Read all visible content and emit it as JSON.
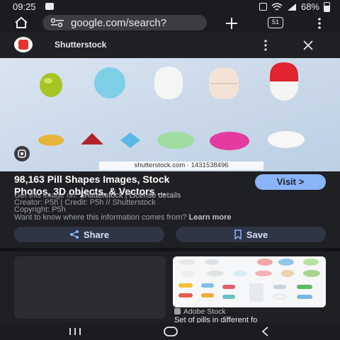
{
  "status_bar": {
    "time": "09:25",
    "battery": "68%"
  },
  "browser": {
    "url": "google.com/search?",
    "tab_count": "51"
  },
  "sheet": {
    "site_name": "Shutterstock"
  },
  "image": {
    "watermark": "shutterstock.com · 1431538496"
  },
  "result": {
    "title_line1": "98,163 Pill Shapes Images, Stock",
    "title_line2": "Photos, 3D objects, & Vectors ...",
    "visit_label": "Visit >",
    "get_prefix": "Get this image on: ",
    "get_source": "Shutterstock | License details",
    "creator": "Creator: P5h | Credit: P5h // Shutterstock",
    "copyright": "Copyright: P5h",
    "want_to_know": "Want to know where this information comes from? ",
    "learn_more": "Learn more"
  },
  "actions": {
    "share_label": "Share",
    "save_label": "Save"
  },
  "related": {
    "source": "Adobe Stock",
    "caption": "Set of pills in different fo"
  },
  "colors": {
    "accent": "#8ab4f8",
    "background": "#1f2023",
    "logo_red": "#e8322b"
  }
}
